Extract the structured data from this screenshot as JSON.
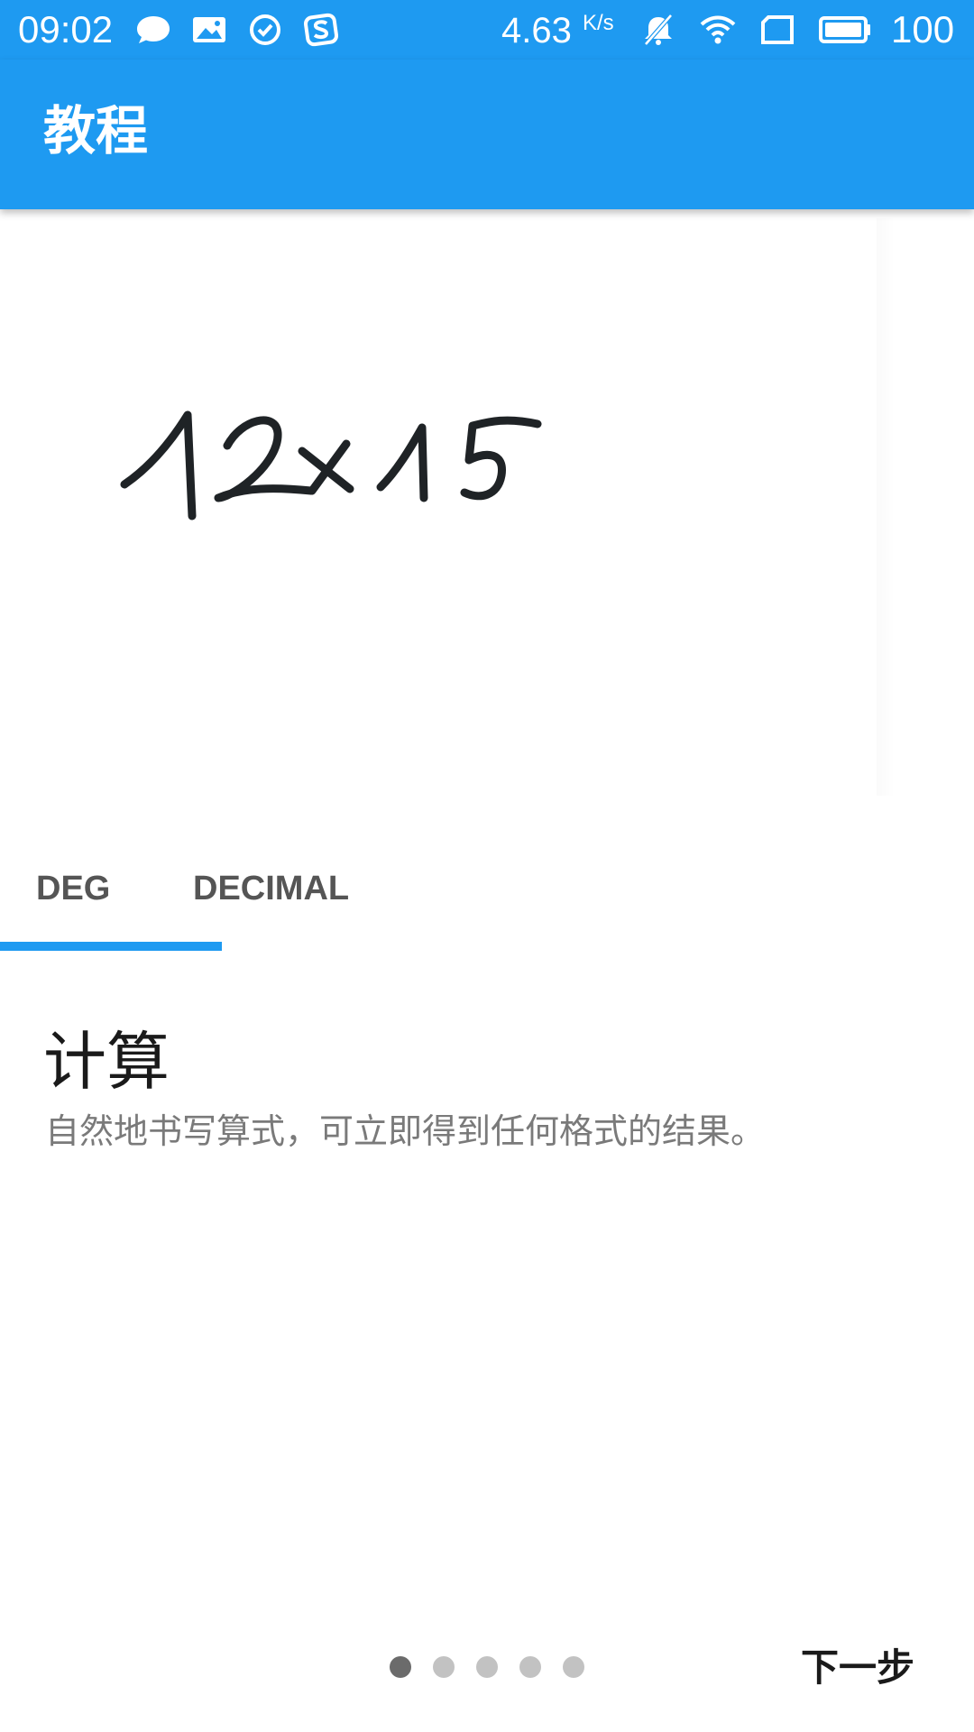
{
  "status_bar": {
    "time": "09:02",
    "left_icons": [
      "chat-bubble-icon",
      "image-icon",
      "check-circle-icon",
      "sogou-icon"
    ],
    "net_speed_value": "4.63",
    "net_speed_unit": "K/s",
    "right_icons": [
      "bell-off-icon",
      "wifi-icon",
      "sim-card-icon",
      "battery-icon"
    ],
    "battery_level": "100"
  },
  "app_bar": {
    "title": "教程",
    "color": "#1E9AF1"
  },
  "illustration": {
    "handwriting": "12x15"
  },
  "tabs": [
    {
      "label": "DEG",
      "selected": true
    },
    {
      "label": "DECIMAL",
      "selected": false
    }
  ],
  "content": {
    "title": "计算",
    "description": "自然地书写算式，可立即得到任何格式的结果。"
  },
  "pager": {
    "page_count": 5,
    "current_page": 1
  },
  "actions": {
    "next_label": "下一步"
  }
}
